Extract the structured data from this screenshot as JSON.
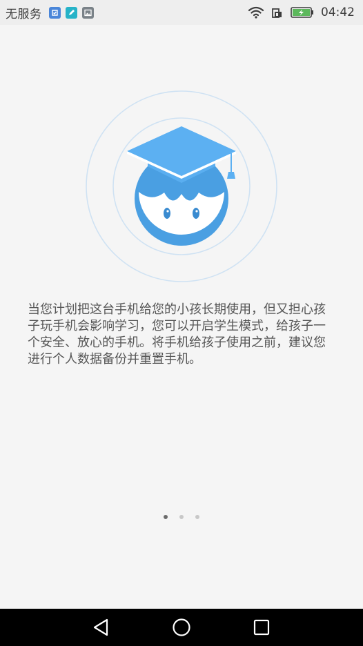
{
  "status_bar": {
    "carrier": "无服务",
    "time": "04:42",
    "notification_icons": [
      "app-store-icon",
      "notes-icon",
      "gallery-icon"
    ],
    "system_icons": [
      "wifi-icon",
      "sim-icon",
      "battery-charging-icon"
    ],
    "colors": {
      "background": "#eeeeee",
      "battery": "#5cb85c"
    }
  },
  "illustration": {
    "icon": "student-graduation-cap-icon",
    "colors": {
      "primary": "#4a9fe2",
      "ring": "#cfe2f3"
    }
  },
  "description": "当您计划把这台手机给您的小孩长期使用，但又担心孩子玩手机会影响学习，您可以开启学生模式，给孩子一个安全、放心的手机。将手机给孩子使用之前，建议您进行个人数据备份并重置手机。",
  "pager": {
    "total": 3,
    "current": 1
  },
  "nav_bar": {
    "buttons": [
      "back-icon",
      "home-icon",
      "recents-icon"
    ]
  }
}
